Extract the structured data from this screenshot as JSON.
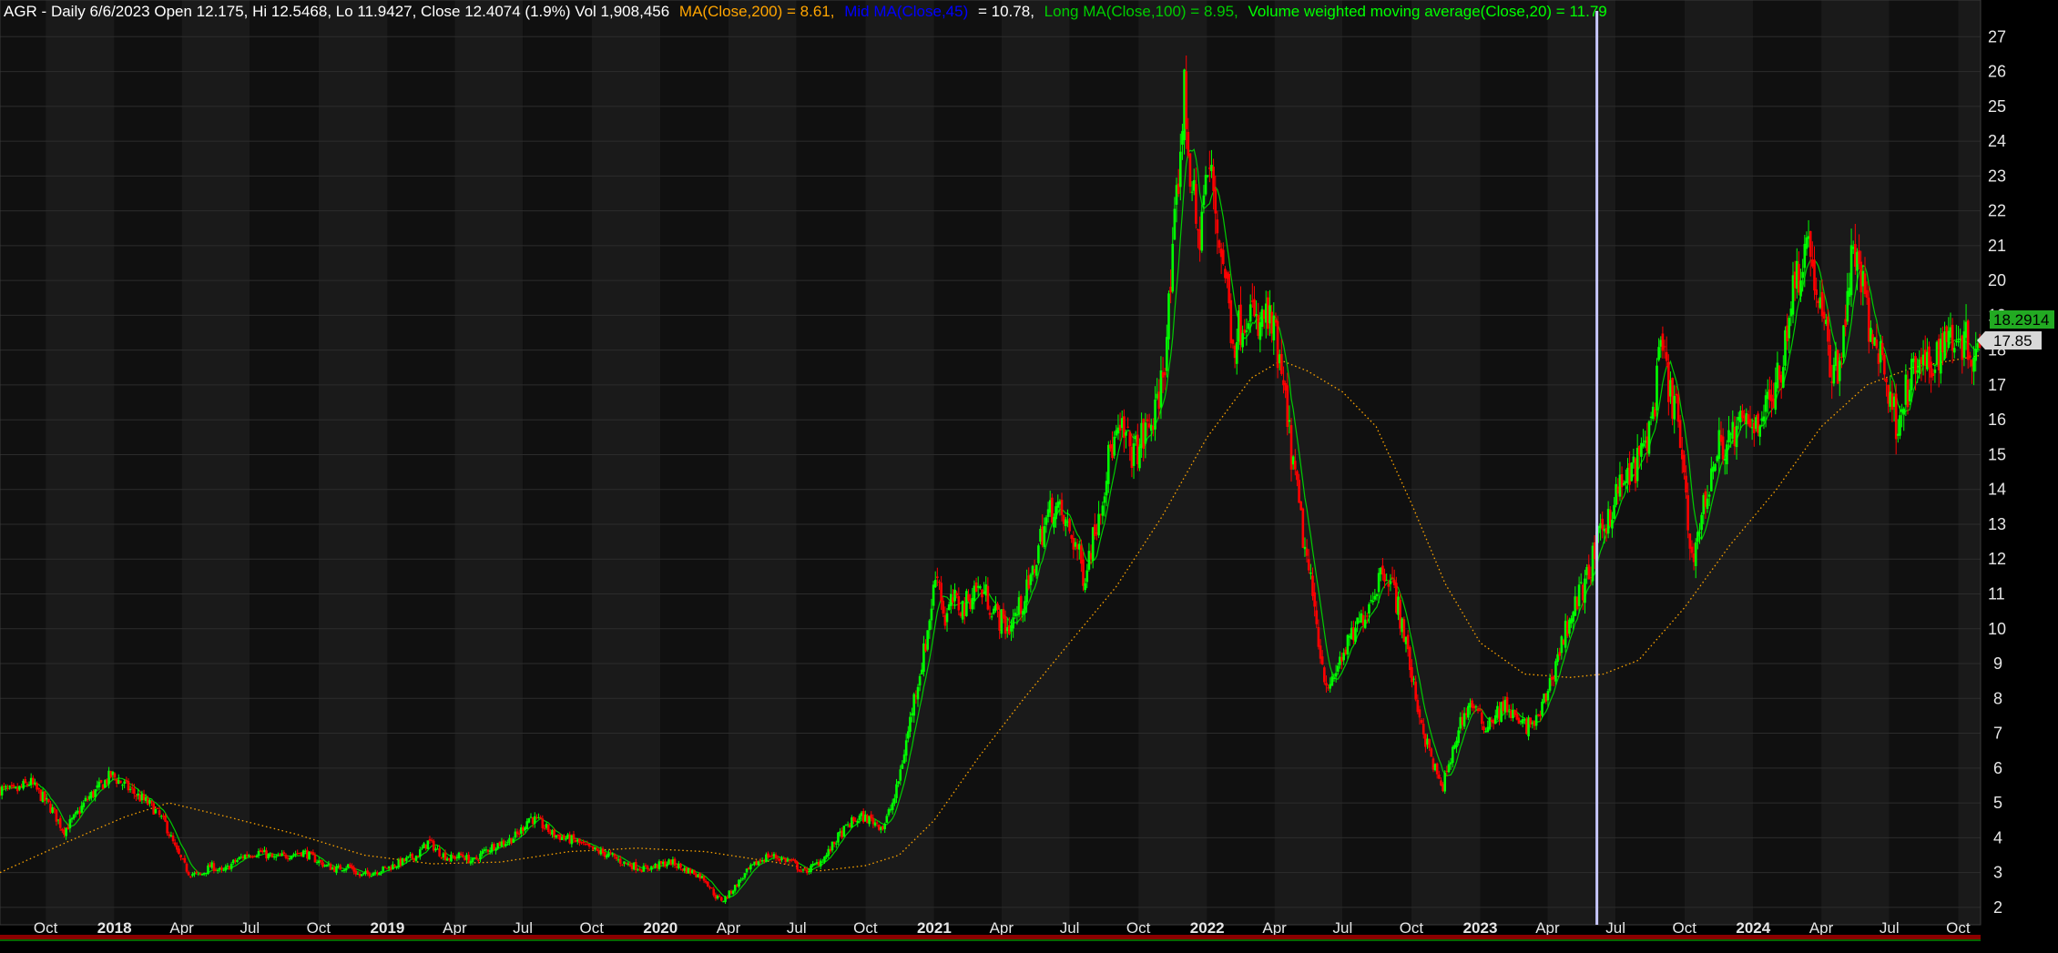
{
  "header": {
    "symbol_text": "AGR - Daily 6/6/2023 Open 12.175, Hi 12.5468, Lo 11.9427, Close 12.4074 (1.9%) Vol 1,908,456",
    "ma200_text": "MA(Close,200) = 8.61,",
    "mid_ma_text": "Mid MA(Close,45)",
    "mid_ma_value": "= 10.78,",
    "long_ma_text": "Long MA(Close,100) = 8.95,",
    "vwma_text": "Volume weighted moving average(Close,20) = 11.79"
  },
  "price_tags": {
    "last_price": "18.2914",
    "ma_value": "17.85"
  },
  "colors": {
    "background": "#000000",
    "band_light": "#1a1a1a",
    "band_dark": "#101010",
    "up_candle": "#00ff00",
    "down_candle": "#ff0000",
    "ma200": "#ffa500",
    "mid_ma": "#0000ff",
    "long_ma": "#00cc00",
    "vwma": "#00ff00",
    "cursor_line": "#c8c8ff",
    "text": "#e6e6e6"
  },
  "chart_data": {
    "type": "candlestick",
    "y_axis_side": "right",
    "ylim": [
      1.5,
      27.4
    ],
    "yticks": [
      2,
      3,
      4,
      5,
      6,
      7,
      8,
      9,
      10,
      11,
      12,
      13,
      14,
      15,
      16,
      17,
      18,
      19,
      20,
      21,
      22,
      23,
      24,
      25,
      26,
      27
    ],
    "xlim": [
      "2017-08-01",
      "2024-10-31"
    ],
    "xticks": [
      {
        "date": "2017-10-01",
        "label": "Oct",
        "year": false
      },
      {
        "date": "2018-01-01",
        "label": "2018",
        "year": true
      },
      {
        "date": "2018-04-01",
        "label": "Apr",
        "year": false
      },
      {
        "date": "2018-07-01",
        "label": "Jul",
        "year": false
      },
      {
        "date": "2018-10-01",
        "label": "Oct",
        "year": false
      },
      {
        "date": "2019-01-01",
        "label": "2019",
        "year": true
      },
      {
        "date": "2019-04-01",
        "label": "Apr",
        "year": false
      },
      {
        "date": "2019-07-01",
        "label": "Jul",
        "year": false
      },
      {
        "date": "2019-10-01",
        "label": "Oct",
        "year": false
      },
      {
        "date": "2020-01-01",
        "label": "2020",
        "year": true
      },
      {
        "date": "2020-04-01",
        "label": "Apr",
        "year": false
      },
      {
        "date": "2020-07-01",
        "label": "Jul",
        "year": false
      },
      {
        "date": "2020-10-01",
        "label": "Oct",
        "year": false
      },
      {
        "date": "2021-01-01",
        "label": "2021",
        "year": true
      },
      {
        "date": "2021-04-01",
        "label": "Apr",
        "year": false
      },
      {
        "date": "2021-07-01",
        "label": "Jul",
        "year": false
      },
      {
        "date": "2021-10-01",
        "label": "Oct",
        "year": false
      },
      {
        "date": "2022-01-01",
        "label": "2022",
        "year": true
      },
      {
        "date": "2022-04-01",
        "label": "Apr",
        "year": false
      },
      {
        "date": "2022-07-01",
        "label": "Jul",
        "year": false
      },
      {
        "date": "2022-10-01",
        "label": "Oct",
        "year": false
      },
      {
        "date": "2023-01-01",
        "label": "2023",
        "year": true
      },
      {
        "date": "2023-04-01",
        "label": "Apr",
        "year": false
      },
      {
        "date": "2023-07-01",
        "label": "Jul",
        "year": false
      },
      {
        "date": "2023-10-01",
        "label": "Oct",
        "year": false
      },
      {
        "date": "2024-01-01",
        "label": "2024",
        "year": true
      },
      {
        "date": "2024-04-01",
        "label": "Apr",
        "year": false
      },
      {
        "date": "2024-07-01",
        "label": "Jul",
        "year": false
      },
      {
        "date": "2024-10-01",
        "label": "Oct",
        "year": false
      }
    ],
    "cursor_date": "2023-06-06",
    "last_price": 18.2914,
    "ma_last": 17.85,
    "price_path": [
      [
        "2017-08-01",
        5.4
      ],
      [
        "2017-08-20",
        5.3
      ],
      [
        "2017-09-10",
        5.6
      ],
      [
        "2017-09-25",
        5.2
      ],
      [
        "2017-10-10",
        4.8
      ],
      [
        "2017-10-25",
        4.2
      ],
      [
        "2017-11-10",
        4.6
      ],
      [
        "2017-11-25",
        5.1
      ],
      [
        "2017-12-10",
        5.4
      ],
      [
        "2017-12-28",
        5.8
      ],
      [
        "2018-01-15",
        5.5
      ],
      [
        "2018-02-01",
        5.2
      ],
      [
        "2018-02-20",
        4.9
      ],
      [
        "2018-03-10",
        4.4
      ],
      [
        "2018-03-25",
        3.6
      ],
      [
        "2018-04-10",
        3.0
      ],
      [
        "2018-04-25",
        2.9
      ],
      [
        "2018-05-10",
        3.2
      ],
      [
        "2018-05-25",
        3.0
      ],
      [
        "2018-06-10",
        3.3
      ],
      [
        "2018-06-25",
        3.5
      ],
      [
        "2018-07-15",
        3.6
      ],
      [
        "2018-08-01",
        3.4
      ],
      [
        "2018-08-20",
        3.5
      ],
      [
        "2018-09-10",
        3.6
      ],
      [
        "2018-09-25",
        3.4
      ],
      [
        "2018-10-10",
        3.2
      ],
      [
        "2018-10-25",
        3.1
      ],
      [
        "2018-11-10",
        3.2
      ],
      [
        "2018-11-25",
        2.9
      ],
      [
        "2018-12-10",
        3.0
      ],
      [
        "2018-12-28",
        3.1
      ],
      [
        "2019-01-20",
        3.3
      ],
      [
        "2019-02-10",
        3.5
      ],
      [
        "2019-02-25",
        3.9
      ],
      [
        "2019-03-10",
        3.6
      ],
      [
        "2019-03-25",
        3.4
      ],
      [
        "2019-04-10",
        3.5
      ],
      [
        "2019-04-25",
        3.3
      ],
      [
        "2019-05-10",
        3.6
      ],
      [
        "2019-05-25",
        3.8
      ],
      [
        "2019-06-10",
        3.9
      ],
      [
        "2019-06-25",
        4.1
      ],
      [
        "2019-07-10",
        4.6
      ],
      [
        "2019-07-25",
        4.4
      ],
      [
        "2019-08-10",
        4.1
      ],
      [
        "2019-08-25",
        4.0
      ],
      [
        "2019-09-10",
        3.9
      ],
      [
        "2019-09-25",
        3.7
      ],
      [
        "2019-10-10",
        3.6
      ],
      [
        "2019-10-25",
        3.5
      ],
      [
        "2019-11-10",
        3.3
      ],
      [
        "2019-11-25",
        3.2
      ],
      [
        "2019-12-10",
        3.1
      ],
      [
        "2019-12-28",
        3.2
      ],
      [
        "2020-01-15",
        3.3
      ],
      [
        "2020-02-01",
        3.1
      ],
      [
        "2020-02-15",
        3.0
      ],
      [
        "2020-03-01",
        2.8
      ],
      [
        "2020-03-15",
        2.3
      ],
      [
        "2020-03-25",
        2.2
      ],
      [
        "2020-04-10",
        2.6
      ],
      [
        "2020-04-25",
        3.0
      ],
      [
        "2020-05-10",
        3.3
      ],
      [
        "2020-05-25",
        3.5
      ],
      [
        "2020-06-10",
        3.4
      ],
      [
        "2020-06-25",
        3.3
      ],
      [
        "2020-07-10",
        3.0
      ],
      [
        "2020-07-25",
        3.2
      ],
      [
        "2020-08-10",
        3.5
      ],
      [
        "2020-08-25",
        4.0
      ],
      [
        "2020-09-10",
        4.4
      ],
      [
        "2020-09-25",
        4.6
      ],
      [
        "2020-10-10",
        4.5
      ],
      [
        "2020-10-25",
        4.3
      ],
      [
        "2020-11-10",
        5.2
      ],
      [
        "2020-11-25",
        6.8
      ],
      [
        "2020-12-05",
        8.0
      ],
      [
        "2020-12-20",
        9.5
      ],
      [
        "2021-01-05",
        11.8
      ],
      [
        "2021-01-15",
        10.2
      ],
      [
        "2021-01-25",
        10.8
      ],
      [
        "2021-02-10",
        10.6
      ],
      [
        "2021-02-25",
        11.2
      ],
      [
        "2021-03-10",
        11.0
      ],
      [
        "2021-03-25",
        10.4
      ],
      [
        "2021-04-10",
        10.0
      ],
      [
        "2021-04-25",
        10.6
      ],
      [
        "2021-05-10",
        11.3
      ],
      [
        "2021-05-25",
        12.8
      ],
      [
        "2021-06-10",
        13.6
      ],
      [
        "2021-06-25",
        13.0
      ],
      [
        "2021-07-10",
        12.4
      ],
      [
        "2021-07-20",
        11.5
      ],
      [
        "2021-08-01",
        12.6
      ],
      [
        "2021-08-15",
        14.0
      ],
      [
        "2021-08-25",
        15.2
      ],
      [
        "2021-09-10",
        15.6
      ],
      [
        "2021-09-25",
        15.0
      ],
      [
        "2021-10-10",
        15.6
      ],
      [
        "2021-10-25",
        16.2
      ],
      [
        "2021-11-05",
        17.8
      ],
      [
        "2021-11-15",
        20.2
      ],
      [
        "2021-11-25",
        23.5
      ],
      [
        "2021-12-01",
        25.4
      ],
      [
        "2021-12-10",
        23.0
      ],
      [
        "2021-12-20",
        21.0
      ],
      [
        "2021-12-28",
        22.6
      ],
      [
        "2022-01-05",
        23.2
      ],
      [
        "2022-01-15",
        21.5
      ],
      [
        "2022-01-25",
        20.2
      ],
      [
        "2022-02-05",
        18.2
      ],
      [
        "2022-02-15",
        18.8
      ],
      [
        "2022-02-25",
        19.3
      ],
      [
        "2022-03-10",
        18.5
      ],
      [
        "2022-03-20",
        19.0
      ],
      [
        "2022-04-01",
        18.4
      ],
      [
        "2022-04-15",
        16.5
      ],
      [
        "2022-04-25",
        14.8
      ],
      [
        "2022-05-10",
        12.5
      ],
      [
        "2022-05-25",
        10.5
      ],
      [
        "2022-06-05",
        8.8
      ],
      [
        "2022-06-15",
        8.2
      ],
      [
        "2022-06-25",
        9.0
      ],
      [
        "2022-07-10",
        9.6
      ],
      [
        "2022-07-25",
        10.2
      ],
      [
        "2022-08-10",
        11.0
      ],
      [
        "2022-08-25",
        11.8
      ],
      [
        "2022-09-05",
        11.3
      ],
      [
        "2022-09-20",
        10.0
      ],
      [
        "2022-10-05",
        8.2
      ],
      [
        "2022-10-20",
        6.8
      ],
      [
        "2022-11-01",
        6.0
      ],
      [
        "2022-11-10",
        5.4
      ],
      [
        "2022-11-20",
        6.0
      ],
      [
        "2022-12-05",
        7.3
      ],
      [
        "2022-12-20",
        7.9
      ],
      [
        "2023-01-05",
        7.2
      ],
      [
        "2023-01-20",
        7.5
      ],
      [
        "2023-02-05",
        7.8
      ],
      [
        "2023-02-20",
        7.3
      ],
      [
        "2023-03-05",
        7.2
      ],
      [
        "2023-03-20",
        7.4
      ],
      [
        "2023-04-05",
        8.5
      ],
      [
        "2023-04-20",
        9.6
      ],
      [
        "2023-05-05",
        10.6
      ],
      [
        "2023-05-20",
        11.2
      ],
      [
        "2023-06-06",
        12.4
      ],
      [
        "2023-06-20",
        13.2
      ],
      [
        "2023-07-05",
        14.0
      ],
      [
        "2023-07-20",
        14.4
      ],
      [
        "2023-08-05",
        15.0
      ],
      [
        "2023-08-20",
        16.2
      ],
      [
        "2023-09-01",
        18.2
      ],
      [
        "2023-09-10",
        16.8
      ],
      [
        "2023-09-20",
        16.4
      ],
      [
        "2023-10-01",
        14.0
      ],
      [
        "2023-10-10",
        12.0
      ],
      [
        "2023-10-20",
        12.8
      ],
      [
        "2023-11-01",
        14.0
      ],
      [
        "2023-11-15",
        15.2
      ],
      [
        "2023-12-01",
        15.4
      ],
      [
        "2023-12-15",
        15.8
      ],
      [
        "2024-01-05",
        16.0
      ],
      [
        "2024-01-20",
        16.4
      ],
      [
        "2024-02-05",
        17.2
      ],
      [
        "2024-02-20",
        19.5
      ],
      [
        "2024-03-05",
        20.6
      ],
      [
        "2024-03-15",
        21.2
      ],
      [
        "2024-03-25",
        19.8
      ],
      [
        "2024-04-05",
        18.6
      ],
      [
        "2024-04-15",
        17.4
      ],
      [
        "2024-04-25",
        17.6
      ],
      [
        "2024-05-05",
        19.4
      ],
      [
        "2024-05-15",
        21.0
      ],
      [
        "2024-05-25",
        20.0
      ],
      [
        "2024-06-05",
        18.4
      ],
      [
        "2024-06-20",
        18.0
      ],
      [
        "2024-07-01",
        16.6
      ],
      [
        "2024-07-10",
        16.0
      ],
      [
        "2024-07-25",
        16.9
      ],
      [
        "2024-08-10",
        17.6
      ],
      [
        "2024-08-25",
        17.4
      ],
      [
        "2024-09-05",
        18.0
      ],
      [
        "2024-09-20",
        18.5
      ],
      [
        "2024-10-05",
        18.4
      ],
      [
        "2024-10-20",
        18.0
      ],
      [
        "2024-10-31",
        18.29
      ]
    ],
    "ma200_path": [
      [
        "2017-08-01",
        3.0
      ],
      [
        "2017-11-01",
        3.9
      ],
      [
        "2018-01-15",
        4.6
      ],
      [
        "2018-03-15",
        5.0
      ],
      [
        "2018-06-01",
        4.6
      ],
      [
        "2018-09-01",
        4.1
      ],
      [
        "2018-12-01",
        3.5
      ],
      [
        "2019-03-01",
        3.25
      ],
      [
        "2019-06-01",
        3.3
      ],
      [
        "2019-09-01",
        3.6
      ],
      [
        "2019-12-01",
        3.7
      ],
      [
        "2020-03-01",
        3.6
      ],
      [
        "2020-06-01",
        3.3
      ],
      [
        "2020-08-01",
        3.05
      ],
      [
        "2020-10-01",
        3.2
      ],
      [
        "2020-11-15",
        3.5
      ],
      [
        "2021-01-01",
        4.5
      ],
      [
        "2021-03-01",
        6.3
      ],
      [
        "2021-05-01",
        8.0
      ],
      [
        "2021-07-01",
        9.6
      ],
      [
        "2021-09-01",
        11.2
      ],
      [
        "2021-11-01",
        13.2
      ],
      [
        "2022-01-01",
        15.5
      ],
      [
        "2022-03-01",
        17.2
      ],
      [
        "2022-04-10",
        17.7
      ],
      [
        "2022-05-15",
        17.4
      ],
      [
        "2022-07-01",
        16.8
      ],
      [
        "2022-08-15",
        15.8
      ],
      [
        "2022-10-01",
        13.6
      ],
      [
        "2022-11-15",
        11.3
      ],
      [
        "2023-01-01",
        9.6
      ],
      [
        "2023-03-01",
        8.7
      ],
      [
        "2023-05-01",
        8.6
      ],
      [
        "2023-06-15",
        8.7
      ],
      [
        "2023-08-01",
        9.1
      ],
      [
        "2023-10-01",
        10.6
      ],
      [
        "2023-12-01",
        12.4
      ],
      [
        "2024-02-01",
        14.0
      ],
      [
        "2024-04-01",
        15.8
      ],
      [
        "2024-06-01",
        17.0
      ],
      [
        "2024-08-01",
        17.5
      ],
      [
        "2024-10-31",
        17.85
      ]
    ]
  }
}
